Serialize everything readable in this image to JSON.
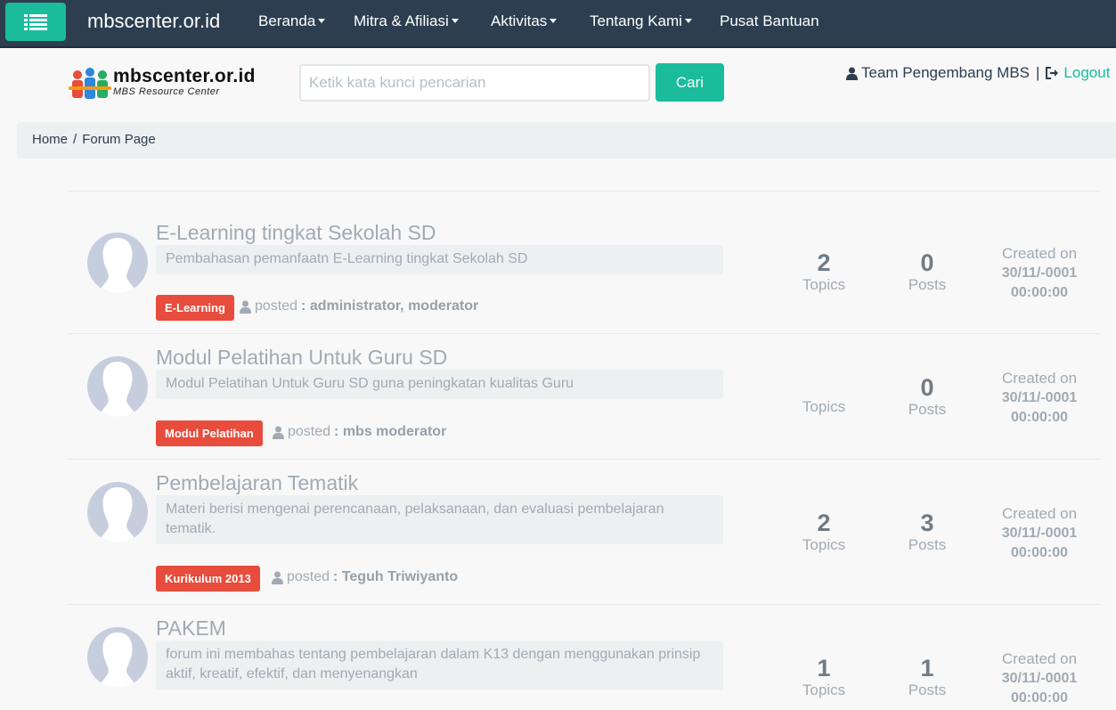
{
  "navbar": {
    "brand": "mbscenter.or.id",
    "menu_icon": "list-icon",
    "items": [
      {
        "label": "Beranda",
        "dropdown": true
      },
      {
        "label": "Mitra & Afiliasi",
        "dropdown": true
      },
      {
        "label": "Aktivitas",
        "dropdown": true
      },
      {
        "label": "Tentang Kami",
        "dropdown": true
      },
      {
        "label": "Pusat Bantuan",
        "dropdown": false
      }
    ]
  },
  "header": {
    "logo_text": "mbscenter.or.id",
    "logo_subtitle": "MBS Resource Center",
    "search_placeholder": "Ketik kata kunci pencarian",
    "search_value": "",
    "search_button": "Cari",
    "user_name": "Team Pengembang MBS",
    "separator": "|",
    "logout_label": "Logout"
  },
  "breadcrumb": {
    "items": [
      "Home",
      "Forum Page"
    ],
    "separator": "/"
  },
  "forums": [
    {
      "title": "E-Learning tingkat Sekolah SD",
      "description": "Pembahasan pemanfaatn E-Learning tingkat Sekolah SD",
      "tag": "E-Learning",
      "posted_label": "posted",
      "posted_by": ": administrator, moderator",
      "topics_count": "2",
      "topics_label": "Topics",
      "posts_count": "0",
      "posts_label": "Posts",
      "created_label": "Created on",
      "created_date": "30/11/-0001",
      "created_time": "00:00:00"
    },
    {
      "title": "Modul Pelatihan Untuk Guru SD",
      "description": "Modul Pelatihan Untuk Guru SD guna peningkatan kualitas Guru",
      "tag": "Modul Pelatihan",
      "posted_label": "posted",
      "posted_by": ": mbs moderator",
      "topics_count": "",
      "topics_label": "Topics",
      "posts_count": "0",
      "posts_label": "Posts",
      "created_label": "Created on",
      "created_date": "30/11/-0001",
      "created_time": "00:00:00"
    },
    {
      "title": "Pembelajaran Tematik",
      "description": "Materi berisi mengenai perencanaan, pelaksanaan, dan evaluasi pembelajaran tematik.",
      "tag": "Kurikulum 2013",
      "posted_label": "posted",
      "posted_by": ": Teguh Triwiyanto",
      "topics_count": "2",
      "topics_label": "Topics",
      "posts_count": "3",
      "posts_label": "Posts",
      "created_label": "Created on",
      "created_date": "30/11/-0001",
      "created_time": "00:00:00"
    },
    {
      "title": "PAKEM",
      "description": "forum ini membahas tentang pembelajaran dalam K13 dengan menggunakan prinsip aktif, kreatif, efektif, dan menyenangkan",
      "topics_count": "1",
      "topics_label": "Topics",
      "posts_count": "1",
      "posts_label": "Posts",
      "created_label": "Created on",
      "created_date": "30/11/-0001",
      "created_time": "00:00:00"
    }
  ],
  "colors": {
    "navbar_bg": "#2c3e50",
    "accent": "#1abc9c",
    "tag_bg": "#e74c3c",
    "muted_text": "#a1aab3"
  }
}
